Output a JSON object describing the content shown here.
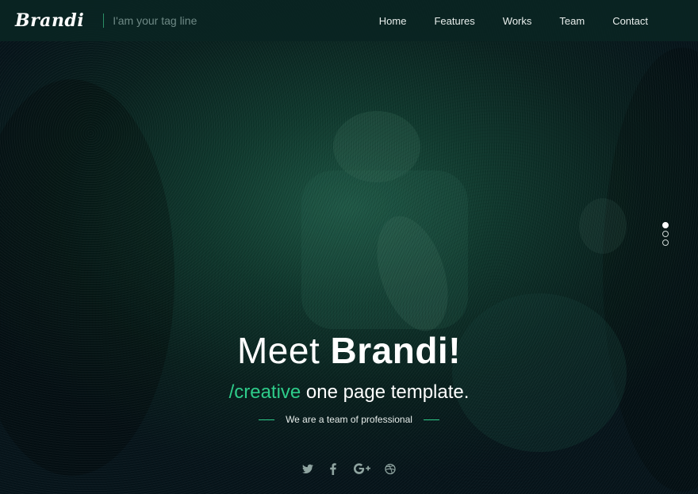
{
  "header": {
    "logo": "Brandi",
    "tagline": "I'am your tag line",
    "nav": [
      "Home",
      "Features",
      "Works",
      "Team",
      "Contact"
    ]
  },
  "slider": {
    "dots": 3,
    "active_index": 0
  },
  "hero": {
    "title_prefix": "Meet ",
    "title_strong": "Brandi!",
    "sub_accent": "/creative",
    "sub_rest": " one page template.",
    "line": "We are a team of professional"
  },
  "socials": [
    "twitter-icon",
    "facebook-icon",
    "google-plus-icon",
    "dribbble-icon"
  ],
  "colors": {
    "accent": "#2ecc8a",
    "header_bg": "#0a2422",
    "text": "#ffffff"
  }
}
